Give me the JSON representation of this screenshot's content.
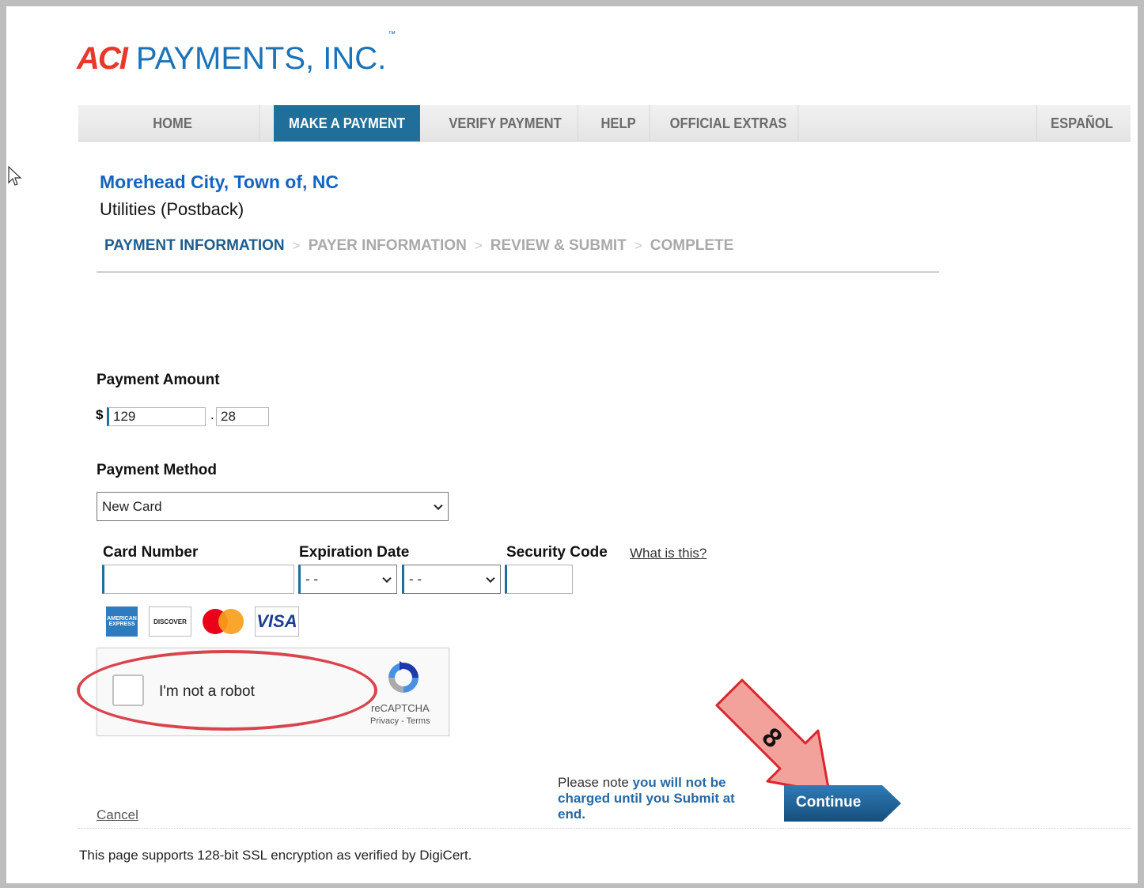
{
  "brand": {
    "mark": "ACI",
    "name": "PAYMENTS, INC.",
    "tm": "™"
  },
  "nav": {
    "home": "HOME",
    "make_payment": "MAKE A PAYMENT",
    "verify_payment": "VERIFY PAYMENT",
    "help": "HELP",
    "official_extras": "OFFICIAL EXTRAS",
    "language": "ESPAÑOL"
  },
  "merchant": {
    "name": "Morehead City, Town of, NC",
    "service": "Utilities (Postback)"
  },
  "steps": [
    {
      "label": "PAYMENT INFORMATION"
    },
    {
      "label": "PAYER INFORMATION"
    },
    {
      "label": "REVIEW & SUBMIT"
    },
    {
      "label": "COMPLETE"
    }
  ],
  "steps_separator": ">",
  "payment_amount": {
    "label": "Payment Amount",
    "currency": "$",
    "dollars": "129",
    "decimal": ".",
    "cents": "28"
  },
  "payment_method": {
    "label": "Payment Method",
    "selected": "New Card"
  },
  "card": {
    "number_label": "Card Number",
    "number_value": "",
    "expiration_label": "Expiration Date",
    "exp_month": "- -",
    "exp_year": "- -",
    "security_label": "Security Code",
    "security_value": "",
    "what_is_this": "What is this?"
  },
  "card_logos": {
    "amex": "AMERICAN EXPRESS",
    "discover": "DISCOVER",
    "visa": "VISA"
  },
  "captcha": {
    "label": "I'm not a robot",
    "brand": "reCAPTCHA",
    "terms": "Privacy - Terms"
  },
  "annotation": {
    "step_number": "8",
    "oval_color": "#d9444d",
    "arrow_color": "#f2a29a"
  },
  "note": {
    "prefix": "Please note ",
    "emphasis": "you will not be charged until you Submit at end."
  },
  "actions": {
    "continue": "Continue",
    "cancel": "Cancel"
  },
  "footer": {
    "ssl_note": "This page supports 128-bit SSL encryption as verified by DigiCert."
  },
  "colors": {
    "brand_red": "#e8382b",
    "brand_blue": "#1a73b9",
    "nav_active": "#1f6f9a",
    "merchant_blue": "#1564c0",
    "step_active": "#1e5c8e",
    "continue_blue": "#1d5e8f"
  }
}
